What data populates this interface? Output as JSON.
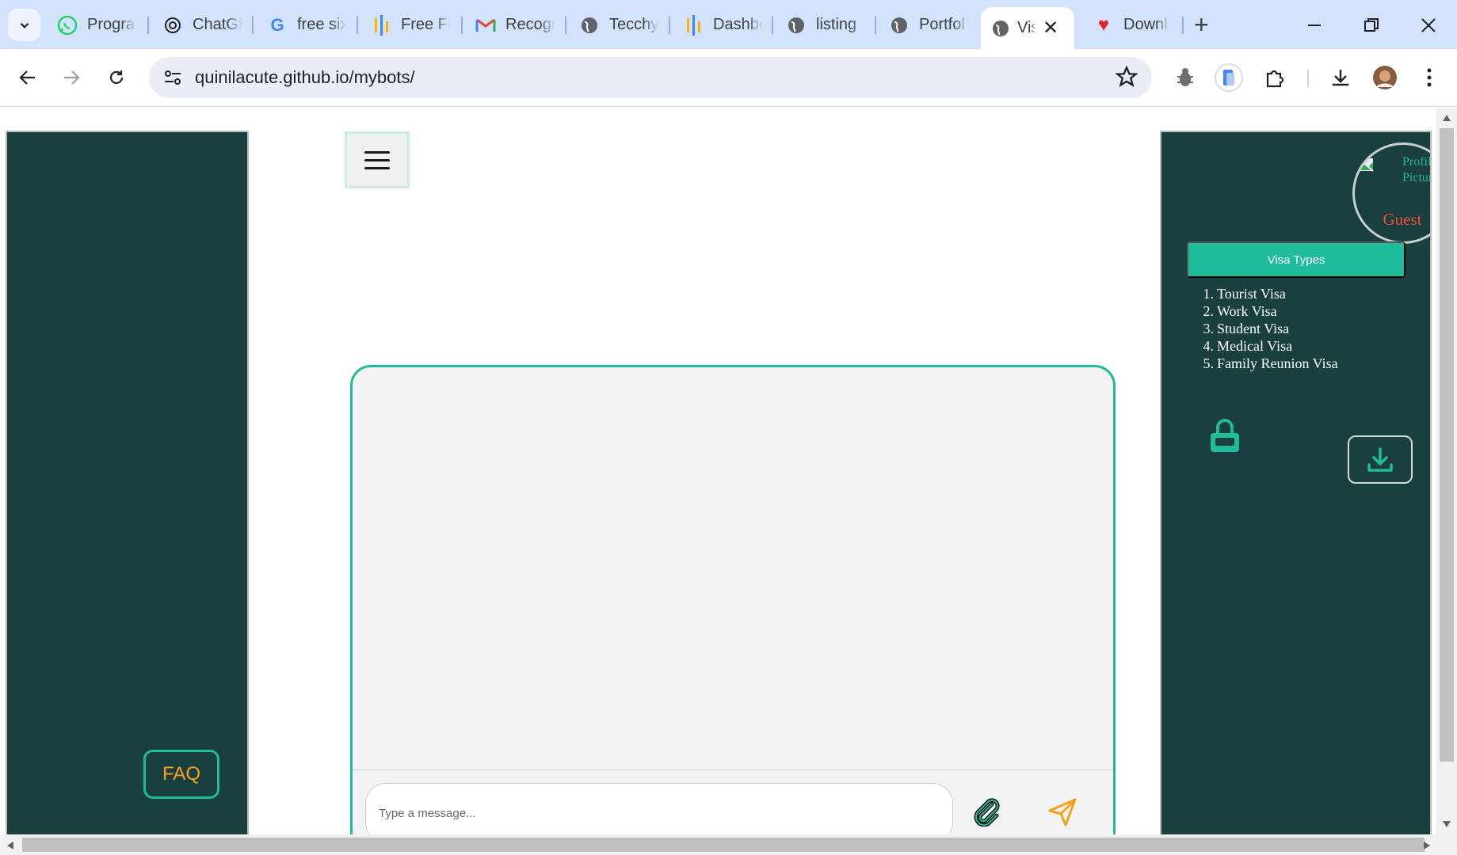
{
  "browser": {
    "tabs": [
      {
        "title": "Program",
        "icon": "whatsapp-icon"
      },
      {
        "title": "ChatGPT",
        "icon": "openai-icon"
      },
      {
        "title": "free six",
        "icon": "google-icon"
      },
      {
        "title": "Free Fr",
        "icon": "bars-logo-icon"
      },
      {
        "title": "Recogn",
        "icon": "gmail-icon"
      },
      {
        "title": "Tecchy",
        "icon": "globe-icon"
      },
      {
        "title": "Dashbo",
        "icon": "bars-logo-icon"
      },
      {
        "title": "listing",
        "icon": "globe-icon"
      },
      {
        "title": "Portfol",
        "icon": "globe-icon"
      },
      {
        "title": "Vis",
        "icon": "globe-icon",
        "active": true
      },
      {
        "title": "Downl",
        "icon": "heart-icon"
      }
    ],
    "url": "quinilacute.github.io/mybots/",
    "accent": "#d3e3fd"
  },
  "left_sidebar": {
    "faq_label": "FAQ"
  },
  "chat": {
    "input_placeholder": "Type a message..."
  },
  "right_sidebar": {
    "profile_alt": "Profile Picture",
    "profile_name": "Guest",
    "visa_button_label": "Visa Types",
    "visa_types": [
      {
        "num": "1.",
        "label": "Tourist Visa"
      },
      {
        "num": "2.",
        "label": "Work Visa"
      },
      {
        "num": "3.",
        "label": "Student Visa"
      },
      {
        "num": "4.",
        "label": "Medical Visa"
      },
      {
        "num": "5.",
        "label": "Family Reunion Visa"
      }
    ]
  },
  "colors": {
    "sidebar_bg": "#193f3e",
    "accent_teal": "#1fbc9c",
    "faq_text": "#f5a21b",
    "guest_text": "#f04b3a",
    "send_icon": "#f5a21b"
  }
}
